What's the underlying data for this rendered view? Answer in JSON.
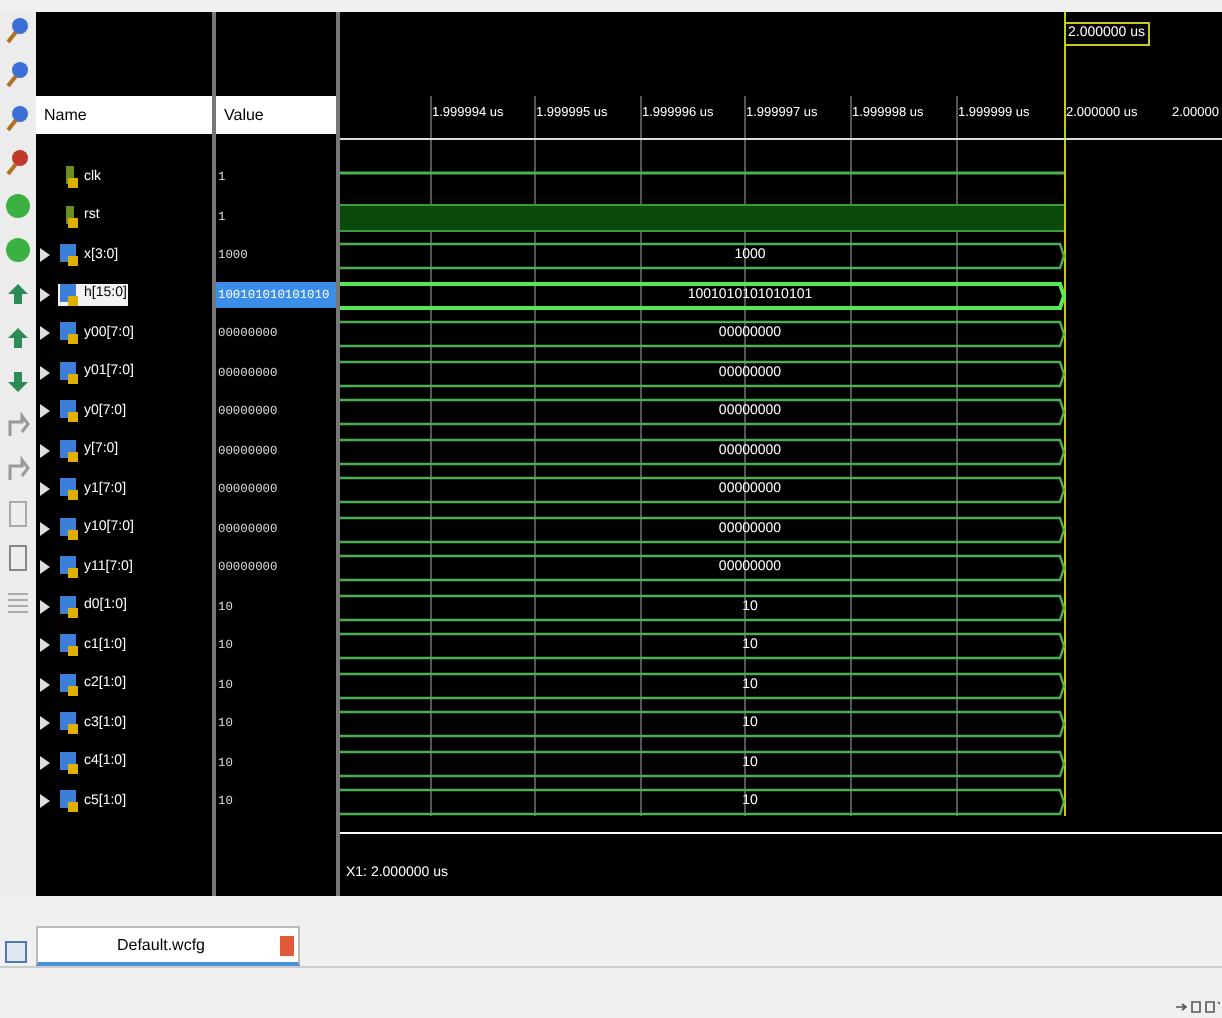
{
  "columns": {
    "name": "Name",
    "value": "Value"
  },
  "ruler": {
    "ticks": [
      "1.999994 us",
      "1.999995 us",
      "1.999996 us",
      "1.999997 us",
      "1.999998 us",
      "1.999999 us",
      "2.000000 us",
      "2.00000"
    ],
    "cursor_label": "2.000000 us"
  },
  "signals": [
    {
      "name": "clk",
      "value": "1",
      "kind": "clock",
      "selected": false
    },
    {
      "name": "rst",
      "value": "1",
      "kind": "bit",
      "selected": false
    },
    {
      "name": "x[3:0]",
      "value": "1000",
      "kind": "bus",
      "wave_value": "1000",
      "selected": false
    },
    {
      "name": "h[15:0]",
      "value": "100101010101010",
      "kind": "bus",
      "wave_value": "1001010101010101",
      "selected": true
    },
    {
      "name": "y00[7:0]",
      "value": "00000000",
      "kind": "bus",
      "wave_value": "00000000",
      "selected": false
    },
    {
      "name": "y01[7:0]",
      "value": "00000000",
      "kind": "bus",
      "wave_value": "00000000",
      "selected": false
    },
    {
      "name": "y0[7:0]",
      "value": "00000000",
      "kind": "bus",
      "wave_value": "00000000",
      "selected": false
    },
    {
      "name": "y[7:0]",
      "value": "00000000",
      "kind": "bus",
      "wave_value": "00000000",
      "selected": false
    },
    {
      "name": "y1[7:0]",
      "value": "00000000",
      "kind": "bus",
      "wave_value": "00000000",
      "selected": false
    },
    {
      "name": "y10[7:0]",
      "value": "00000000",
      "kind": "bus",
      "wave_value": "00000000",
      "selected": false
    },
    {
      "name": "y11[7:0]",
      "value": "00000000",
      "kind": "bus",
      "wave_value": "00000000",
      "selected": false
    },
    {
      "name": "d0[1:0]",
      "value": "10",
      "kind": "bus",
      "wave_value": "10",
      "selected": false
    },
    {
      "name": "c1[1:0]",
      "value": "10",
      "kind": "bus",
      "wave_value": "10",
      "selected": false
    },
    {
      "name": "c2[1:0]",
      "value": "10",
      "kind": "bus",
      "wave_value": "10",
      "selected": false
    },
    {
      "name": "c3[1:0]",
      "value": "10",
      "kind": "bus",
      "wave_value": "10",
      "selected": false
    },
    {
      "name": "c4[1:0]",
      "value": "10",
      "kind": "bus",
      "wave_value": "10",
      "selected": false
    },
    {
      "name": "c5[1:0]",
      "value": "10",
      "kind": "bus",
      "wave_value": "10",
      "selected": false
    }
  ],
  "cursor_readout": "X1: 2.000000 us",
  "tabs": [
    {
      "label": "Default.wcfg",
      "selected": true
    }
  ]
}
